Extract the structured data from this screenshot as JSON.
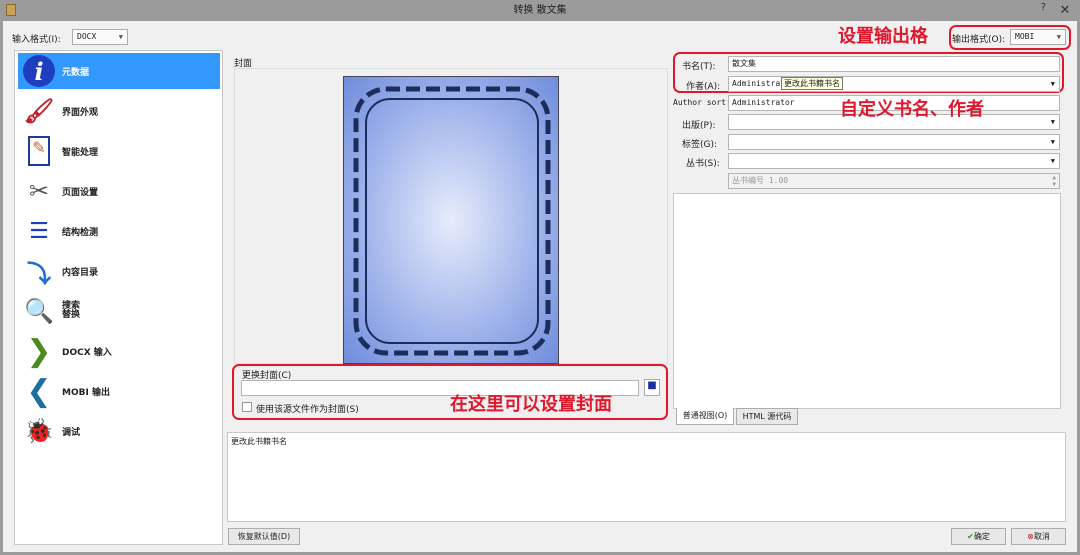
{
  "window": {
    "title": "转换 散文集",
    "help": "?",
    "close": "✕"
  },
  "input_format": {
    "label": "输入格式(I):",
    "value": "DOCX"
  },
  "output_format": {
    "label": "输出格式(O):",
    "value": "MOBI"
  },
  "sidebar": {
    "items": [
      {
        "label": "元数据",
        "icon": "info-icon"
      },
      {
        "label": "界面外观",
        "icon": "brush-icon"
      },
      {
        "label": "智能处理",
        "icon": "document-pencil-icon"
      },
      {
        "label": "页面设置",
        "icon": "tools-icon"
      },
      {
        "label": "结构检测",
        "icon": "numbered-list-icon"
      },
      {
        "label": "内容目录",
        "icon": "toc-icon"
      },
      {
        "label": "搜索\n替换",
        "icon": "magnifier-icon"
      },
      {
        "label": "DOCX 输入",
        "icon": "chevron-right-icon"
      },
      {
        "label": "MOBI 输出",
        "icon": "chevron-left-icon"
      },
      {
        "label": "调试",
        "icon": "bug-icon"
      }
    ]
  },
  "cover": {
    "label": "封面",
    "change_label": "更换封面(C)",
    "path": "",
    "use_source_label": "使用该源文件作为封面(S)",
    "use_source_checked": false
  },
  "metadata": {
    "title_label": "书名(T):",
    "title": "散文集",
    "author_label": "作者(A):",
    "author": "Administrator",
    "tooltip": "更改此书籍书名",
    "author_sort_label": "Author sort:",
    "author_sort": "Administrator",
    "publisher_label": "出版(P):",
    "publisher": "",
    "tags_label": "标签(G):",
    "tags": "",
    "series_label": "丛书(S):",
    "series": "",
    "series_index": "丛书编号 1.00"
  },
  "comments_tabs": [
    "普通视图(O)",
    "HTML 源代码"
  ],
  "description": "更改此书籍书名",
  "annotations": {
    "output": "设置输出格",
    "title_author": "自定义书名、作者",
    "cover": "在这里可以设置封面"
  },
  "buttons": {
    "restore": "恢复默认值(D)",
    "ok": "确定",
    "cancel": "取消"
  },
  "colors": {
    "accent": "#3399ff",
    "annotation": "#e0182e"
  }
}
